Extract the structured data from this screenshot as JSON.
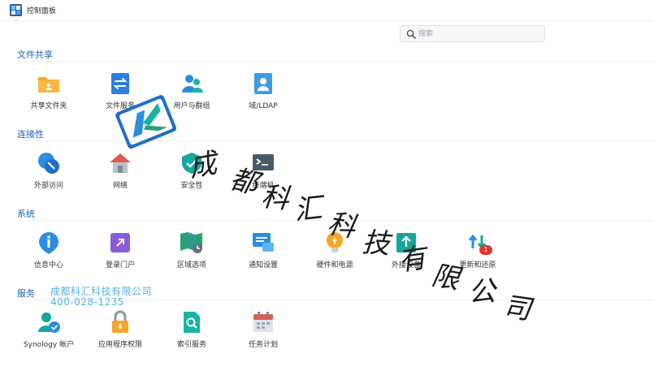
{
  "window": {
    "title": "控制面板"
  },
  "search": {
    "placeholder": "搜索"
  },
  "sections": [
    {
      "title": "文件共享",
      "items": [
        "共享文件夹",
        "文件服务",
        "用户与群组",
        "域/LDAP"
      ]
    },
    {
      "title": "连接性",
      "items": [
        "外部访问",
        "网络",
        "安全性",
        "终端机"
      ]
    },
    {
      "title": "系统",
      "items": [
        "信息中心",
        "登录门户",
        "区域选项",
        "通知设置",
        "硬件和电源",
        "外接设备",
        "更新和还原"
      ]
    },
    {
      "title": "服务",
      "items": [
        "Synology 帐户",
        "应用程序权限",
        "索引服务",
        "任务计划"
      ]
    }
  ],
  "badges": {
    "update_count": "1"
  },
  "watermark": {
    "company_large": [
      "成",
      "都",
      "科",
      "汇",
      "科",
      "技",
      "有",
      "限",
      "公",
      "司"
    ],
    "company": "成都科汇科技有限公司",
    "phone": "400-028-1235"
  },
  "colors": {
    "section_title": "#1d62ad",
    "accent": "#2b8de0"
  }
}
